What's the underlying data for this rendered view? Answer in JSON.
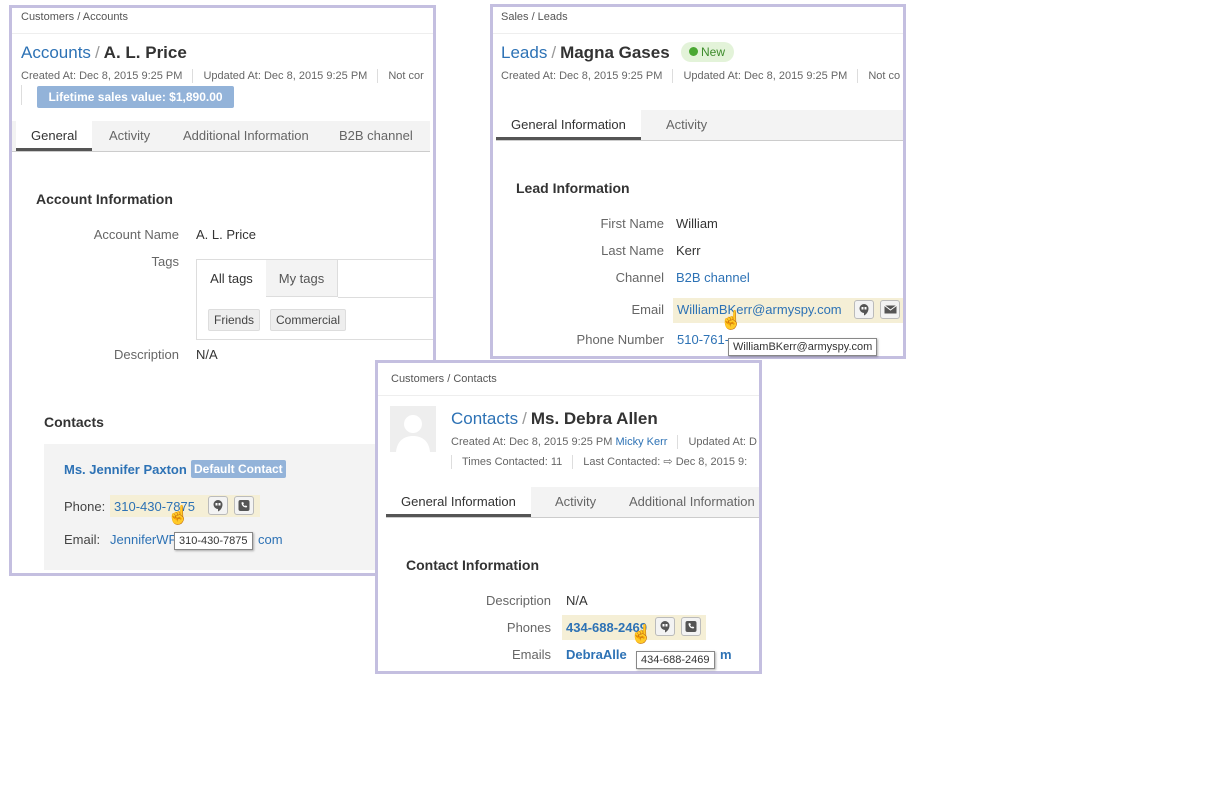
{
  "accounts": {
    "breadcrumb": "Customers / Accounts",
    "entity": "Accounts",
    "name": "A. L. Price",
    "created": "Created At: Dec 8, 2015 9:25 PM",
    "updated": "Updated At: Dec 8, 2015 9:25 PM",
    "extra": "Not cor",
    "lifetime": "Lifetime sales value: $1,890.00",
    "tabs": [
      "General",
      "Activity",
      "Additional Information",
      "B2B channel"
    ],
    "section": "Account Information",
    "account_name_label": "Account Name",
    "account_name": "A. L. Price",
    "tags_label": "Tags",
    "tag_tabs": [
      "All tags",
      "My tags"
    ],
    "tags": [
      "Friends",
      "Commercial"
    ],
    "description_label": "Description",
    "description": "N/A",
    "contacts_title": "Contacts",
    "contact_name": "Ms. Jennifer Paxton",
    "default_badge": "Default Contact",
    "phone_label": "Phone:",
    "phone": "310-430-7875",
    "email_label": "Email:",
    "email_a": "JenniferWP",
    "email_b": "com",
    "tooltip": "310-430-7875"
  },
  "leads": {
    "breadcrumb": "Sales / Leads",
    "entity": "Leads",
    "name": "Magna Gases",
    "status": "New",
    "created": "Created At: Dec 8, 2015 9:25 PM",
    "updated": "Updated At: Dec 8, 2015 9:25 PM",
    "extra": "Not co",
    "tabs": [
      "General Information",
      "Activity"
    ],
    "section": "Lead Information",
    "first_name_label": "First Name",
    "first_name": "William",
    "last_name_label": "Last Name",
    "last_name": "Kerr",
    "channel_label": "Channel",
    "channel": "B2B channel",
    "email_label": "Email",
    "email": "WilliamBKerr@armyspy.com",
    "phone_label": "Phone Number",
    "phone": "510-761-",
    "tooltip": "WilliamBKerr@armyspy.com"
  },
  "contacts": {
    "breadcrumb": "Customers / Contacts",
    "entity": "Contacts",
    "name": "Ms. Debra Allen",
    "created": "Created At: Dec 8, 2015 9:25 PM",
    "owner": "Micky Kerr",
    "updated": "Updated At: D",
    "times_contacted": "Times Contacted: 11",
    "last_contacted": "Last Contacted:",
    "last_contacted_date": "Dec 8, 2015 9:",
    "tabs": [
      "General Information",
      "Activity",
      "Additional Information"
    ],
    "section": "Contact Information",
    "description_label": "Description",
    "description": "N/A",
    "phones_label": "Phones",
    "phone": "434-688-2469",
    "emails_label": "Emails",
    "email_a": "DebraAlle",
    "email_b": "m",
    "tooltip": "434-688-2469"
  },
  "colors": {
    "link": "#2d72b5",
    "border": "#c4bfe0",
    "badge": "#93b3d9",
    "new_bg": "#e3f3d9",
    "new_dot": "#4aa832"
  }
}
